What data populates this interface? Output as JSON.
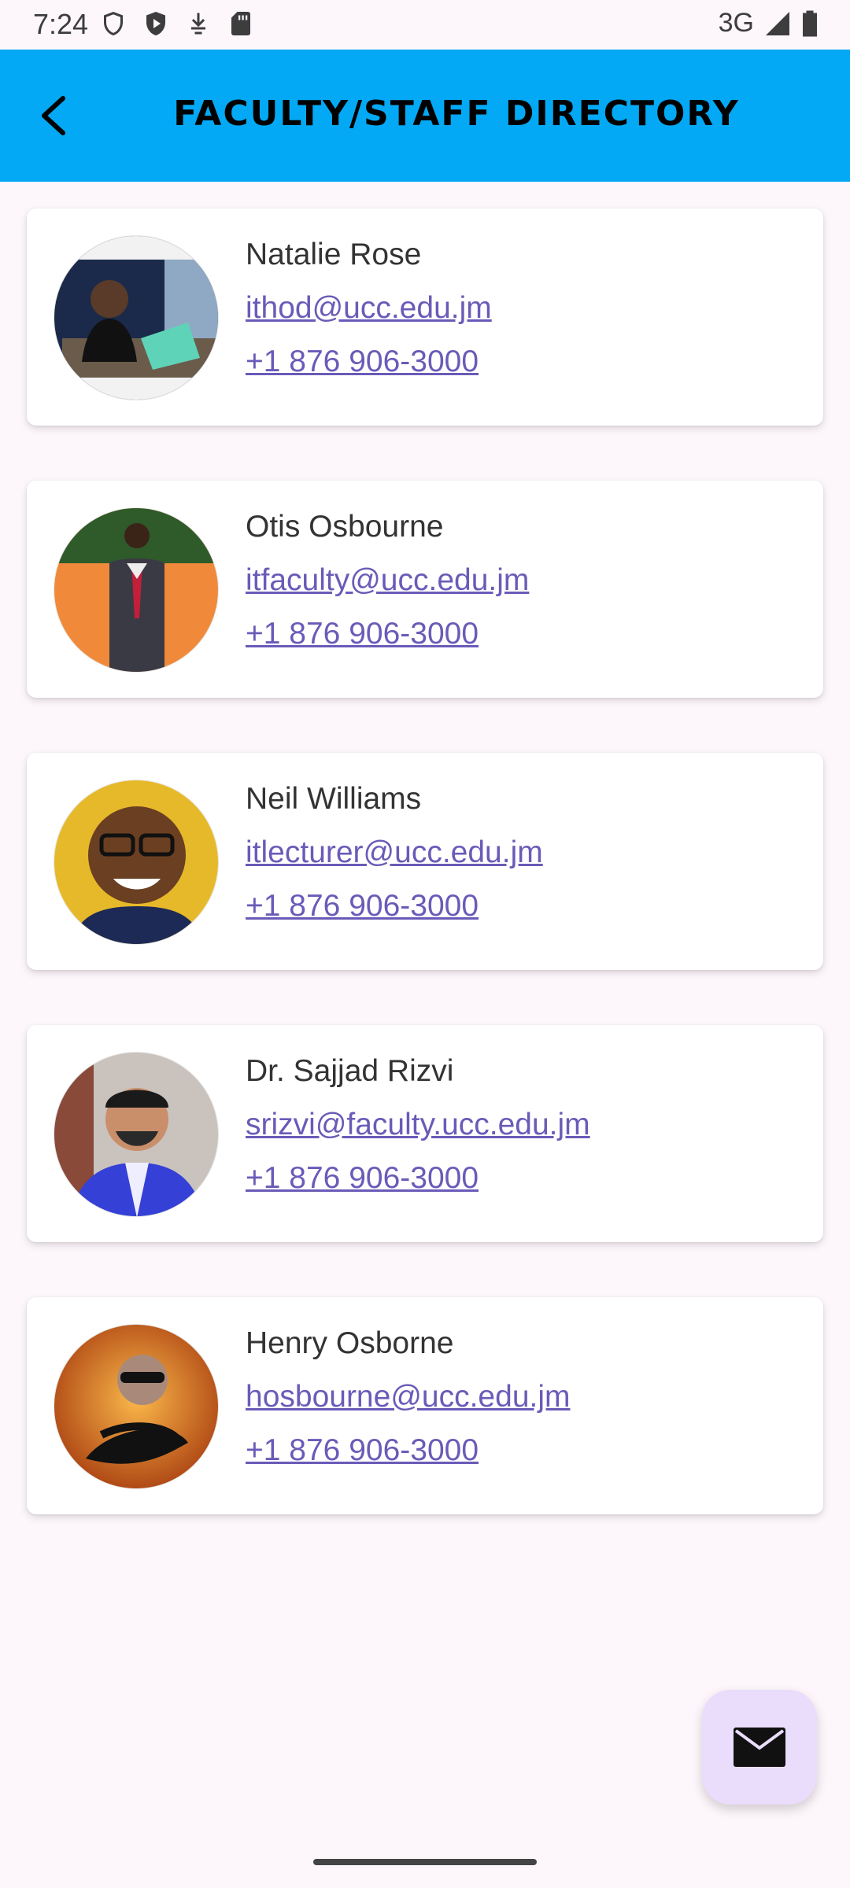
{
  "status_bar": {
    "time": "7:24",
    "network": "3G",
    "icons": [
      "shield-icon",
      "play-protect-icon",
      "download-icon",
      "sd-card-icon",
      "signal-icon",
      "battery-icon"
    ]
  },
  "app_bar": {
    "title": "FACULTY/STAFF DIRECTORY",
    "back_icon": "chevron-left-icon",
    "color": "#03a9f4"
  },
  "faculty": [
    {
      "name": "Natalie Rose",
      "email": "ithod@ucc.edu.jm",
      "phone": "+1 876 906-3000"
    },
    {
      "name": "Otis Osbourne",
      "email": "itfaculty@ucc.edu.jm",
      "phone": "+1 876 906-3000"
    },
    {
      "name": "Neil Williams",
      "email": "itlecturer@ucc.edu.jm",
      "phone": "+1 876 906-3000"
    },
    {
      "name": "Dr. Sajjad Rizvi",
      "email": "srizvi@faculty.ucc.edu.jm",
      "phone": "+1 876 906-3000"
    },
    {
      "name": "Henry Osborne",
      "email": "hosbourne@ucc.edu.jm",
      "phone": "+1 876 906-3000"
    }
  ],
  "fab": {
    "icon": "mail-icon",
    "color": "#e9ddfb"
  },
  "colors": {
    "link": "#6a5bb8",
    "background": "#fdf7fc"
  }
}
